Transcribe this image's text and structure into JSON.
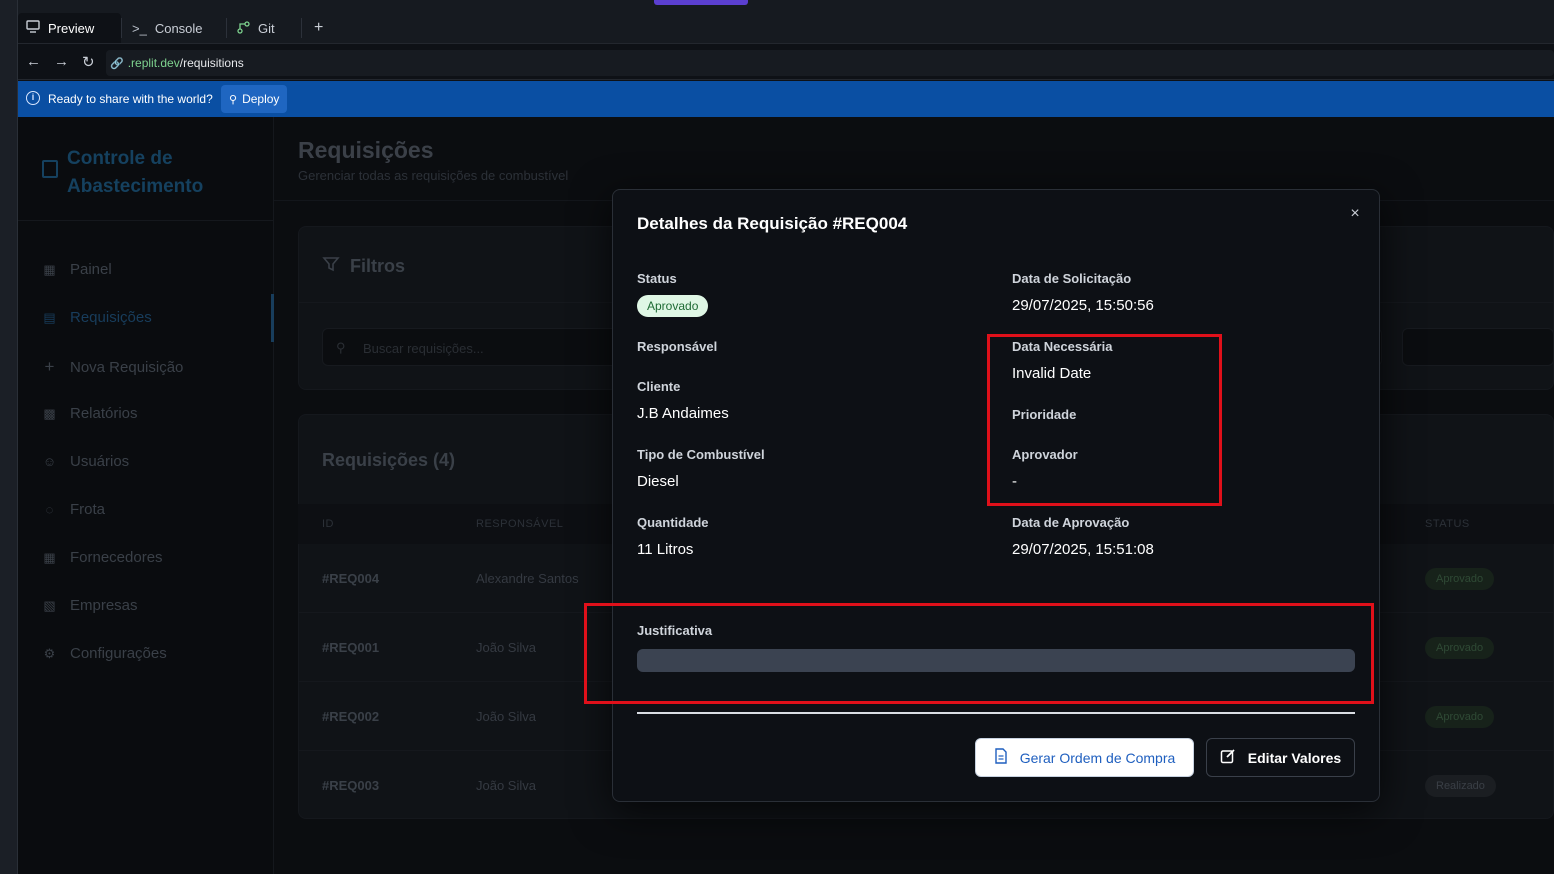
{
  "browser": {
    "tabs": [
      {
        "label": "Preview",
        "icon": "monitor-icon"
      },
      {
        "label": "Console",
        "icon": "terminal-icon"
      },
      {
        "label": "Git",
        "icon": "git-branch-icon"
      }
    ],
    "new_tab_label": "+",
    "url_domain": ".replit.dev",
    "url_path": "/requisitions"
  },
  "banner": {
    "text": "Ready to share with the world?",
    "deploy_label": "Deploy",
    "color": "#0a4fa3"
  },
  "sidebar": {
    "brand": "Controle de Abastecimento",
    "items": [
      {
        "label": "Painel",
        "icon": "dashboard-icon"
      },
      {
        "label": "Requisições",
        "icon": "clipboard-icon",
        "active": true
      },
      {
        "label": "Nova Requisição",
        "icon": "plus-icon"
      },
      {
        "label": "Relatórios",
        "icon": "bar-chart-icon"
      },
      {
        "label": "Usuários",
        "icon": "users-icon"
      },
      {
        "label": "Frota",
        "icon": "car-icon"
      },
      {
        "label": "Fornecedores",
        "icon": "building-icon"
      },
      {
        "label": "Empresas",
        "icon": "office-icon"
      },
      {
        "label": "Configurações",
        "icon": "gear-icon"
      }
    ]
  },
  "page": {
    "title": "Requisições",
    "subtitle": "Gerenciar todas as requisições de combustível",
    "filters_title": "Filtros",
    "search_placeholder": "Buscar requisições...",
    "table_title": "Requisições (4)",
    "columns": {
      "id": "ID",
      "responsavel": "RESPONSÁVEL",
      "status": "STATUS"
    },
    "rows": [
      {
        "id": "#REQ004",
        "responsavel": "Alexandre Santos",
        "status": "Aprovado"
      },
      {
        "id": "#REQ001",
        "responsavel": "João Silva",
        "status": "Aprovado"
      },
      {
        "id": "#REQ002",
        "responsavel": "João Silva",
        "status": "Aprovado"
      },
      {
        "id": "#REQ003",
        "responsavel": "João Silva",
        "status": "Realizado"
      }
    ]
  },
  "modal": {
    "title": "Detalhes da Requisição #REQ004",
    "close_label": "×",
    "left": {
      "status_label": "Status",
      "status_value": "Aprovado",
      "responsavel_label": "Responsável",
      "cliente_label": "Cliente",
      "cliente_value": "J.B Andaimes",
      "combustivel_label": "Tipo de Combustível",
      "combustivel_value": "Diesel",
      "quantidade_label": "Quantidade",
      "quantidade_value": "11 Litros"
    },
    "right": {
      "data_solicitacao_label": "Data de Solicitação",
      "data_solicitacao_value": "29/07/2025, 15:50:56",
      "data_necessaria_label": "Data Necessária",
      "data_necessaria_value": "Invalid Date",
      "prioridade_label": "Prioridade",
      "aprovador_label": "Aprovador",
      "aprovador_value": "-",
      "data_aprovacao_label": "Data de Aprovação",
      "data_aprovacao_value": "29/07/2025, 15:51:08"
    },
    "justificativa_label": "Justificativa",
    "buttons": {
      "gerar_ordem": "Gerar Ordem de Compra",
      "editar_valores": "Editar Valores"
    }
  },
  "colors": {
    "highlight": "#e0101a",
    "status_approved_bg": "#dff7e5",
    "status_approved_text": "#1e6b34",
    "primary_button_text": "#1f5fbf"
  }
}
